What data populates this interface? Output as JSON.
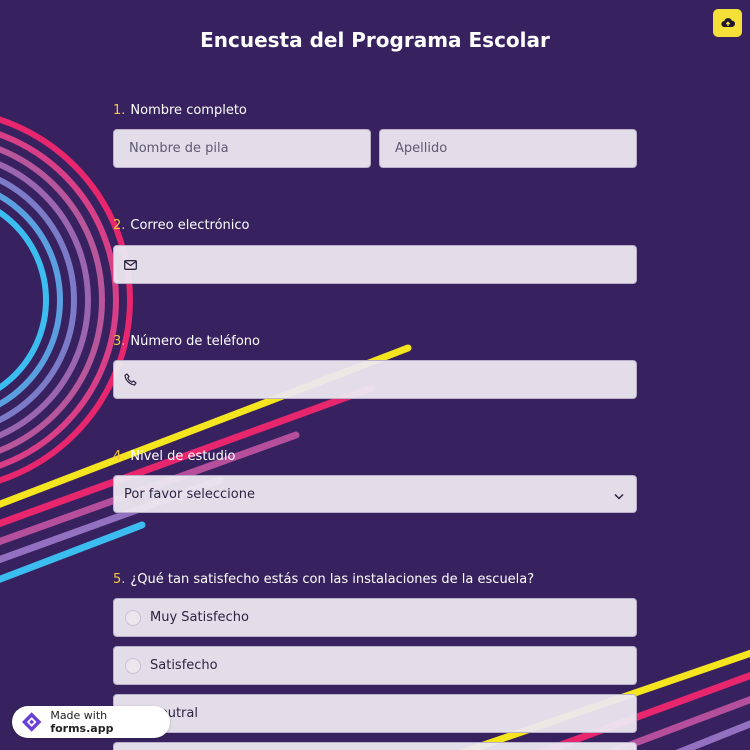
{
  "form": {
    "title": "Encuesta del Programa Escolar"
  },
  "questions": [
    {
      "number": "1.",
      "label": "Nombre completo",
      "first_placeholder": "Nombre de pila",
      "last_placeholder": "Apellido"
    },
    {
      "number": "2.",
      "label": "Correo electrónico",
      "icon": "mail-icon"
    },
    {
      "number": "3.",
      "label": "Número de teléfono",
      "icon": "phone-icon"
    },
    {
      "number": "4.",
      "label": "Nivel de estudio",
      "selected": "Por favor seleccione"
    },
    {
      "number": "5.",
      "label": "¿Qué tan satisfecho estás con las instalaciones de la escuela?",
      "options": [
        "Muy Satisfecho",
        "Satisfecho",
        "Neutral"
      ]
    }
  ],
  "badge": {
    "prefix": "Made with ",
    "brand": "forms.app"
  },
  "colors": {
    "background": "#37225f",
    "accent": "#f5e03a",
    "field": "#ece8f0"
  }
}
